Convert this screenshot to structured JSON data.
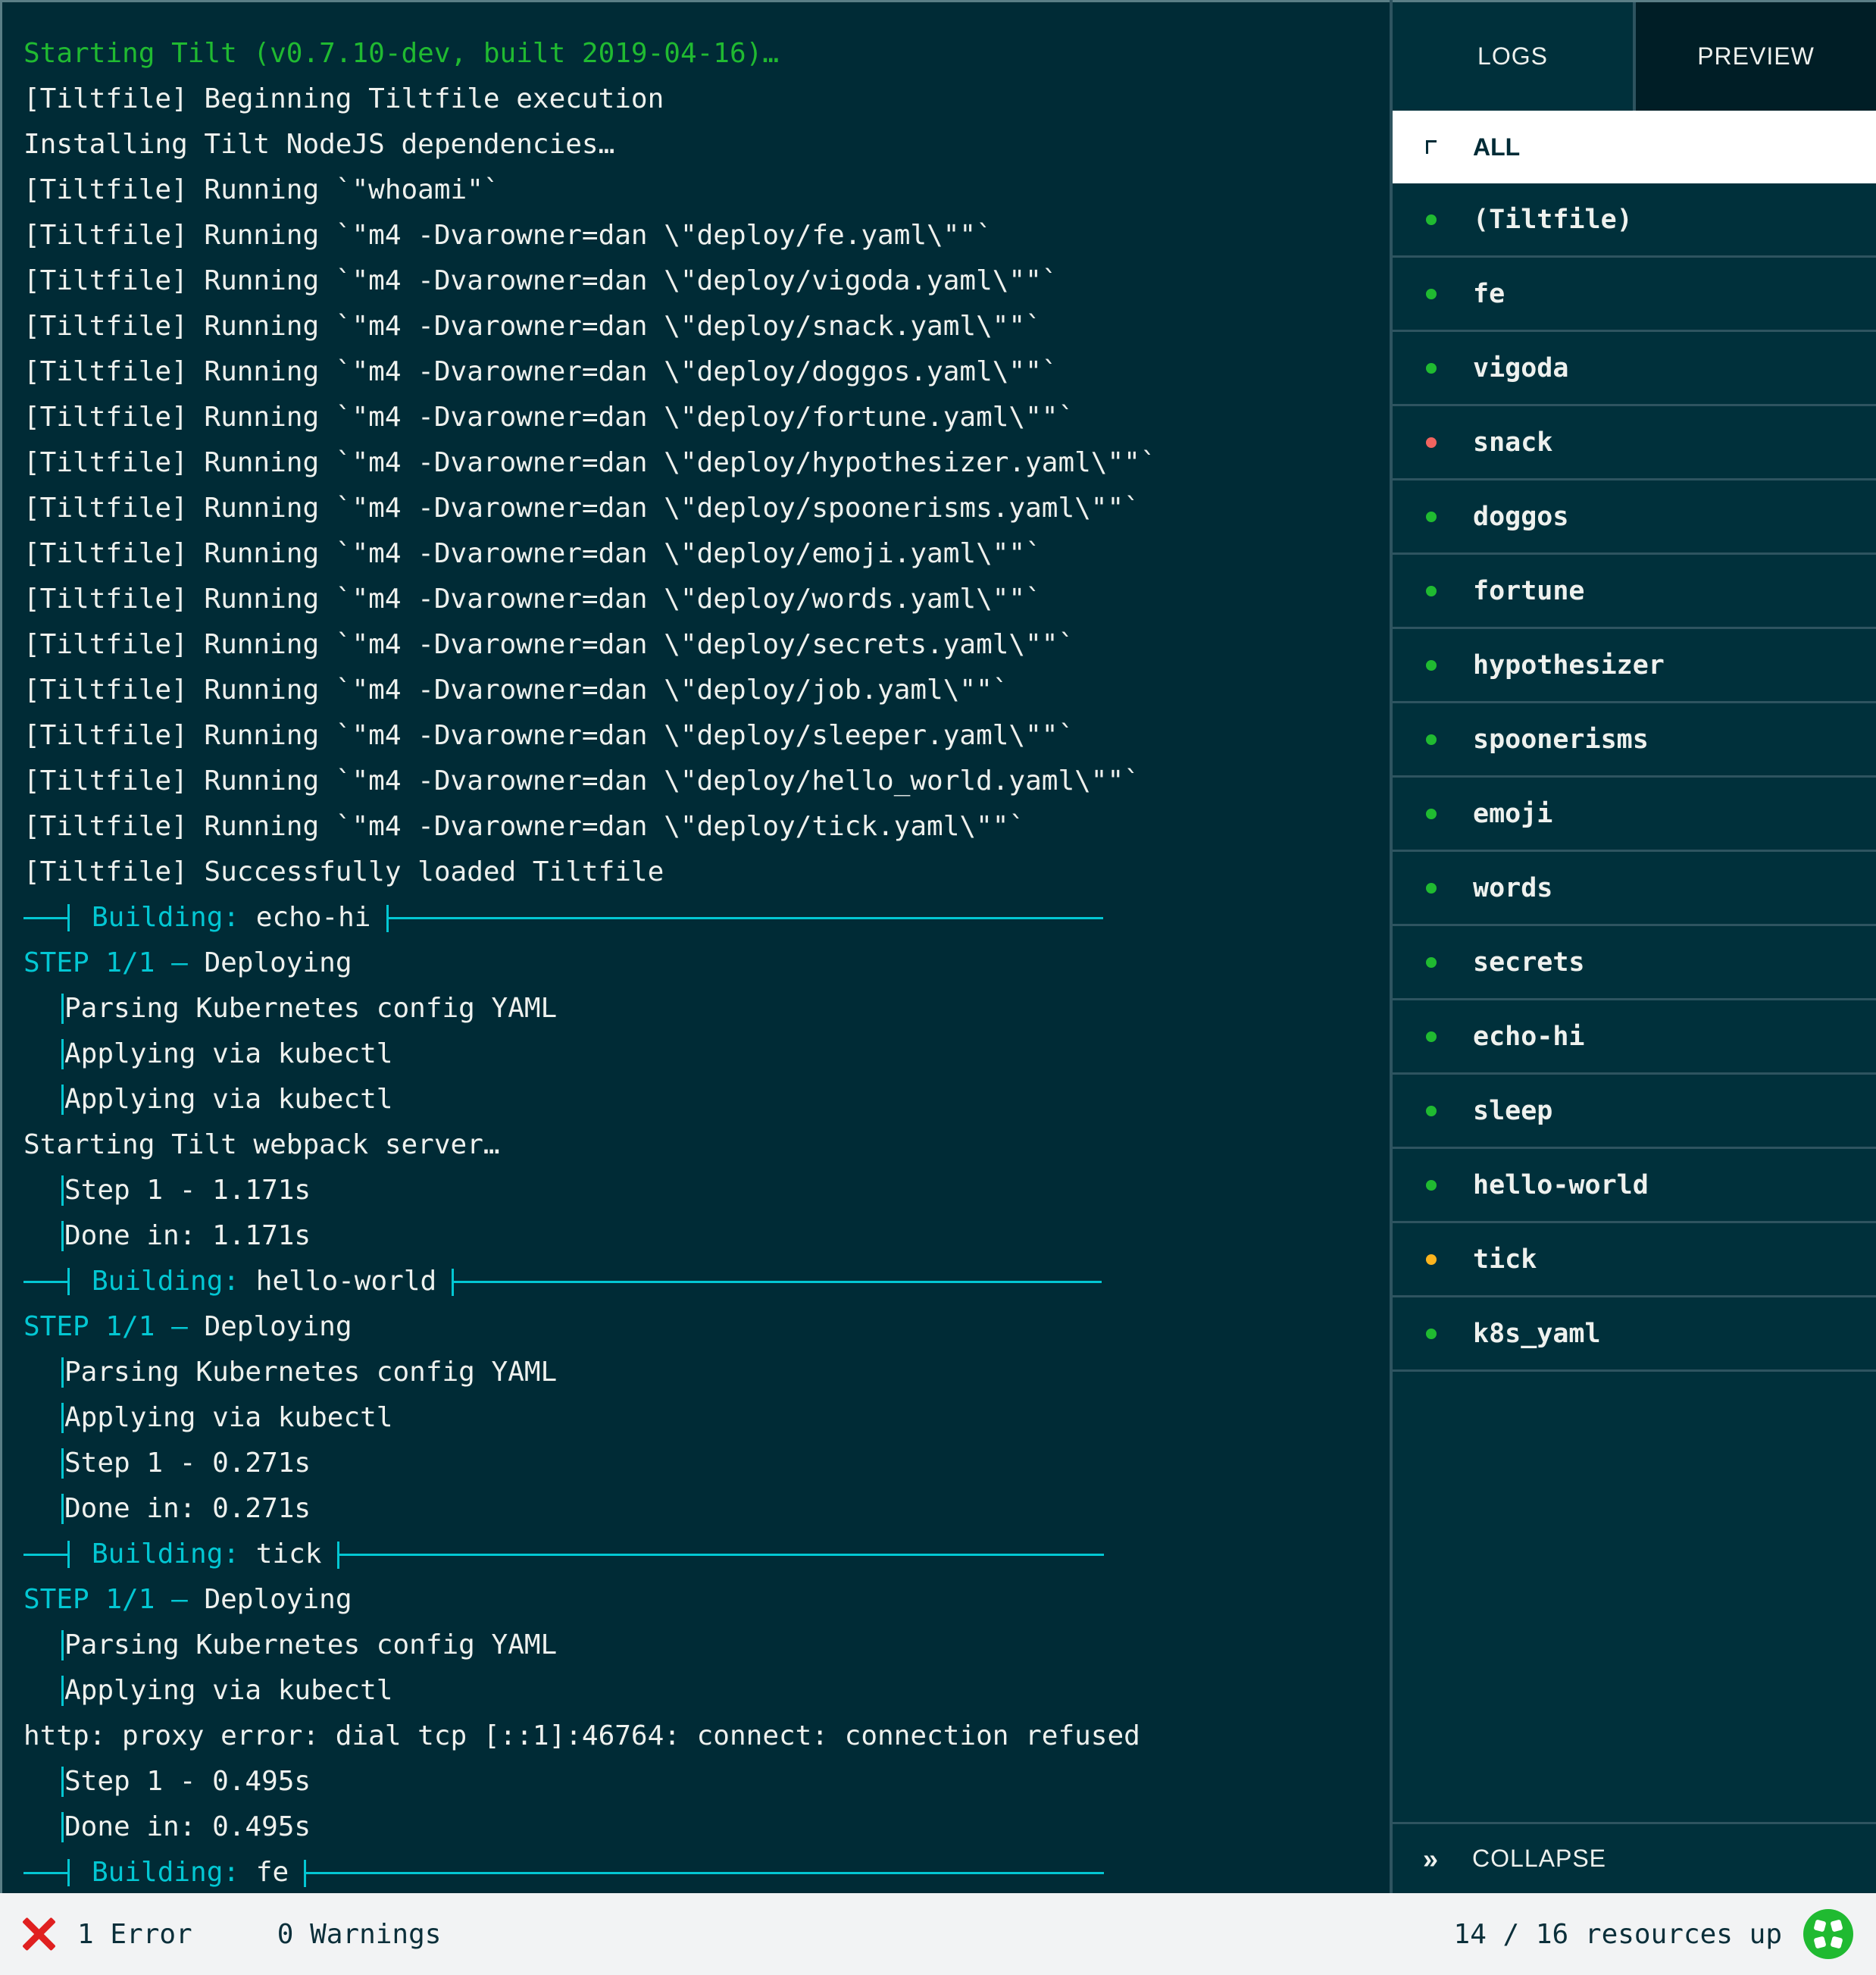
{
  "log": {
    "lines": [
      {
        "kind": "green",
        "text": "Starting Tilt (v0.7.10-dev, built 2019-04-16)…"
      },
      {
        "kind": "plain",
        "text": "[Tiltfile] Beginning Tiltfile execution"
      },
      {
        "kind": "plain",
        "text": "Installing Tilt NodeJS dependencies…"
      },
      {
        "kind": "plain",
        "text": "[Tiltfile] Running `\"whoami\"`"
      },
      {
        "kind": "plain",
        "text": "[Tiltfile] Running `\"m4 -Dvarowner=dan \\\"deploy/fe.yaml\\\"\"`"
      },
      {
        "kind": "plain",
        "text": "[Tiltfile] Running `\"m4 -Dvarowner=dan \\\"deploy/vigoda.yaml\\\"\"`"
      },
      {
        "kind": "plain",
        "text": "[Tiltfile] Running `\"m4 -Dvarowner=dan \\\"deploy/snack.yaml\\\"\"`"
      },
      {
        "kind": "plain",
        "text": "[Tiltfile] Running `\"m4 -Dvarowner=dan \\\"deploy/doggos.yaml\\\"\"`"
      },
      {
        "kind": "plain",
        "text": "[Tiltfile] Running `\"m4 -Dvarowner=dan \\\"deploy/fortune.yaml\\\"\"`"
      },
      {
        "kind": "plain",
        "text": "[Tiltfile] Running `\"m4 -Dvarowner=dan \\\"deploy/hypothesizer.yaml\\\"\"`"
      },
      {
        "kind": "plain",
        "text": "[Tiltfile] Running `\"m4 -Dvarowner=dan \\\"deploy/spoonerisms.yaml\\\"\"`"
      },
      {
        "kind": "plain",
        "text": "[Tiltfile] Running `\"m4 -Dvarowner=dan \\\"deploy/emoji.yaml\\\"\"`"
      },
      {
        "kind": "plain",
        "text": "[Tiltfile] Running `\"m4 -Dvarowner=dan \\\"deploy/words.yaml\\\"\"`"
      },
      {
        "kind": "plain",
        "text": "[Tiltfile] Running `\"m4 -Dvarowner=dan \\\"deploy/secrets.yaml\\\"\"`"
      },
      {
        "kind": "plain",
        "text": "[Tiltfile] Running `\"m4 -Dvarowner=dan \\\"deploy/job.yaml\\\"\"`"
      },
      {
        "kind": "plain",
        "text": "[Tiltfile] Running `\"m4 -Dvarowner=dan \\\"deploy/sleeper.yaml\\\"\"`"
      },
      {
        "kind": "plain",
        "text": "[Tiltfile] Running `\"m4 -Dvarowner=dan \\\"deploy/hello_world.yaml\\\"\"`"
      },
      {
        "kind": "plain",
        "text": "[Tiltfile] Running `\"m4 -Dvarowner=dan \\\"deploy/tick.yaml\\\"\"`"
      },
      {
        "kind": "plain",
        "text": "[Tiltfile] Successfully loaded Tiltfile"
      },
      {
        "kind": "build",
        "label": "Building:",
        "text": "echo-hi"
      },
      {
        "kind": "step",
        "label": "STEP 1/1 —",
        "text": "Deploying"
      },
      {
        "kind": "indent",
        "text": "Parsing Kubernetes config YAML"
      },
      {
        "kind": "indent",
        "text": "Applying via kubectl"
      },
      {
        "kind": "indent",
        "text": "Applying via kubectl"
      },
      {
        "kind": "plain",
        "text": "Starting Tilt webpack server…"
      },
      {
        "kind": "indent",
        "text": "Step 1 - 1.171s"
      },
      {
        "kind": "indent",
        "text": "Done in: 1.171s"
      },
      {
        "kind": "build",
        "label": "Building:",
        "text": "hello-world"
      },
      {
        "kind": "step",
        "label": "STEP 1/1 —",
        "text": "Deploying"
      },
      {
        "kind": "indent",
        "text": "Parsing Kubernetes config YAML"
      },
      {
        "kind": "indent",
        "text": "Applying via kubectl"
      },
      {
        "kind": "indent",
        "text": "Step 1 - 0.271s"
      },
      {
        "kind": "indent",
        "text": "Done in: 0.271s"
      },
      {
        "kind": "build",
        "label": "Building:",
        "text": "tick"
      },
      {
        "kind": "step",
        "label": "STEP 1/1 —",
        "text": "Deploying"
      },
      {
        "kind": "indent",
        "text": "Parsing Kubernetes config YAML"
      },
      {
        "kind": "indent",
        "text": "Applying via kubectl"
      },
      {
        "kind": "plain",
        "text": "http: proxy error: dial tcp [::1]:46764: connect: connection refused"
      },
      {
        "kind": "indent",
        "text": "Step 1 - 0.495s"
      },
      {
        "kind": "indent",
        "text": "Done in: 0.495s"
      },
      {
        "kind": "build",
        "label": "Building:",
        "text": "fe"
      }
    ]
  },
  "sidebar": {
    "tabs": {
      "logs": "LOGS",
      "preview": "PREVIEW"
    },
    "all_label": "ALL",
    "resources": [
      {
        "name": "(Tiltfile)",
        "status": "ok"
      },
      {
        "name": "fe",
        "status": "ok"
      },
      {
        "name": "vigoda",
        "status": "ok"
      },
      {
        "name": "snack",
        "status": "error"
      },
      {
        "name": "doggos",
        "status": "ok"
      },
      {
        "name": "fortune",
        "status": "ok"
      },
      {
        "name": "hypothesizer",
        "status": "ok"
      },
      {
        "name": "spoonerisms",
        "status": "ok"
      },
      {
        "name": "emoji",
        "status": "ok"
      },
      {
        "name": "words",
        "status": "ok"
      },
      {
        "name": "secrets",
        "status": "ok"
      },
      {
        "name": "echo-hi",
        "status": "ok"
      },
      {
        "name": "sleep",
        "status": "ok"
      },
      {
        "name": "hello-world",
        "status": "ok"
      },
      {
        "name": "tick",
        "status": "pending"
      },
      {
        "name": "k8s_yaml",
        "status": "ok"
      }
    ],
    "collapse_label": "COLLAPSE"
  },
  "statusbar": {
    "errors": "1 Error",
    "warnings": "0 Warnings",
    "resources_up": "14 / 16 resources up"
  },
  "colors": {
    "ok": "#20BA31",
    "error": "#F1645F",
    "pending": "#FCB41E",
    "accent": "#03C7D3",
    "background": "#002B36"
  }
}
